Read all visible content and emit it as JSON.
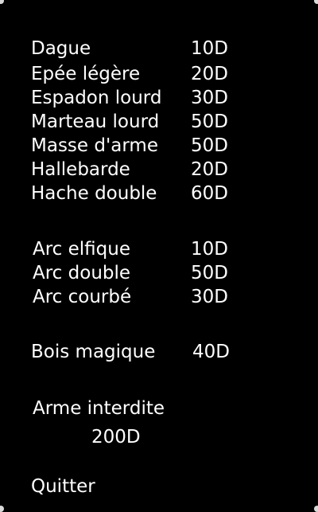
{
  "shop": {
    "weapons": [
      {
        "name": "Dague",
        "price": "10D"
      },
      {
        "name": "Epée légère",
        "price": "20D"
      },
      {
        "name": "Espadon lourd",
        "price": "30D"
      },
      {
        "name": "Marteau lourd",
        "price": "50D"
      },
      {
        "name": "Masse d'arme",
        "price": "50D"
      },
      {
        "name": "Hallebarde",
        "price": "20D"
      },
      {
        "name": "Hache double",
        "price": "60D"
      }
    ],
    "bows": [
      {
        "name": "Arc elfique",
        "price": "10D"
      },
      {
        "name": "Arc double",
        "price": "50D"
      },
      {
        "name": "Arc courbé",
        "price": "30D"
      }
    ],
    "magic": [
      {
        "name": "Bois magique",
        "price": "40D"
      }
    ],
    "forbidden": {
      "name": "Arme interdite",
      "price": "200D"
    },
    "quit_label": "Quitter"
  },
  "colors": {
    "background": "#000000",
    "text": "#ffffff"
  }
}
